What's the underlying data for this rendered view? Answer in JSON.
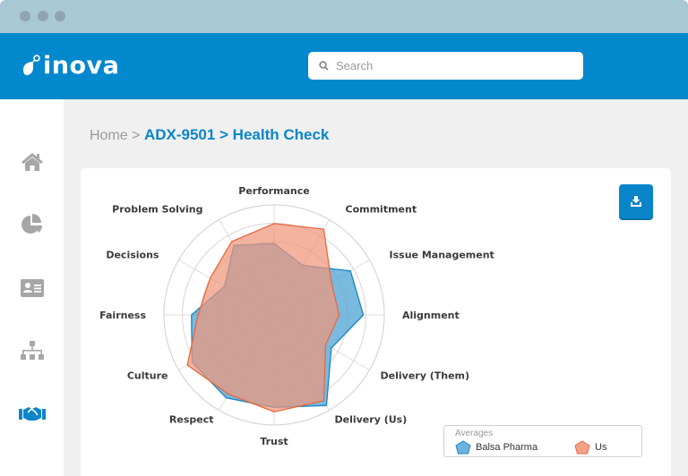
{
  "window": {
    "dots": [
      "close",
      "minimize",
      "maximize"
    ]
  },
  "header": {
    "logo_text": "inova",
    "search": {
      "placeholder": "Search",
      "value": "",
      "icon": "search-icon"
    }
  },
  "sidebar": {
    "items": [
      {
        "name": "home",
        "icon": "home-icon",
        "active": false
      },
      {
        "name": "reports",
        "icon": "pie-chart-icon",
        "active": false
      },
      {
        "name": "contacts",
        "icon": "id-card-icon",
        "active": false
      },
      {
        "name": "organization",
        "icon": "org-chart-icon",
        "active": false
      },
      {
        "name": "partnerships",
        "icon": "handshake-icon",
        "active": true
      }
    ],
    "active_color": "#0a85c9",
    "inactive_color": "#a6a6a6"
  },
  "breadcrumb": {
    "home": "Home",
    "separator": ">",
    "current": "ADX-9501 > Health Check"
  },
  "download_button": {
    "icon": "download-icon",
    "label": "Download"
  },
  "chart_data": {
    "type": "radar",
    "title": "",
    "categories": [
      "Performance",
      "Commitment",
      "Issue Management",
      "Alignment",
      "Delivery (Them)",
      "Delivery (Us)",
      "Trust",
      "Respect",
      "Culture",
      "Fairness",
      "Decisions",
      "Problem Solving"
    ],
    "range": [
      0,
      100
    ],
    "rings": 6,
    "grid": true,
    "legend": {
      "title": "Averages",
      "placement": "bottom-right"
    },
    "series": [
      {
        "name": "Balsa Pharma",
        "color": "#1a85c4",
        "fill": "#58a9d6",
        "values": [
          65,
          52,
          80,
          81,
          60,
          95,
          84,
          87,
          86,
          75,
          52,
          73
        ]
      },
      {
        "name": "Us",
        "color": "#e8693f",
        "fill": "#f0957a",
        "values": [
          83,
          90,
          60,
          59,
          54,
          90,
          88,
          83,
          91,
          69,
          67,
          77
        ]
      }
    ]
  }
}
